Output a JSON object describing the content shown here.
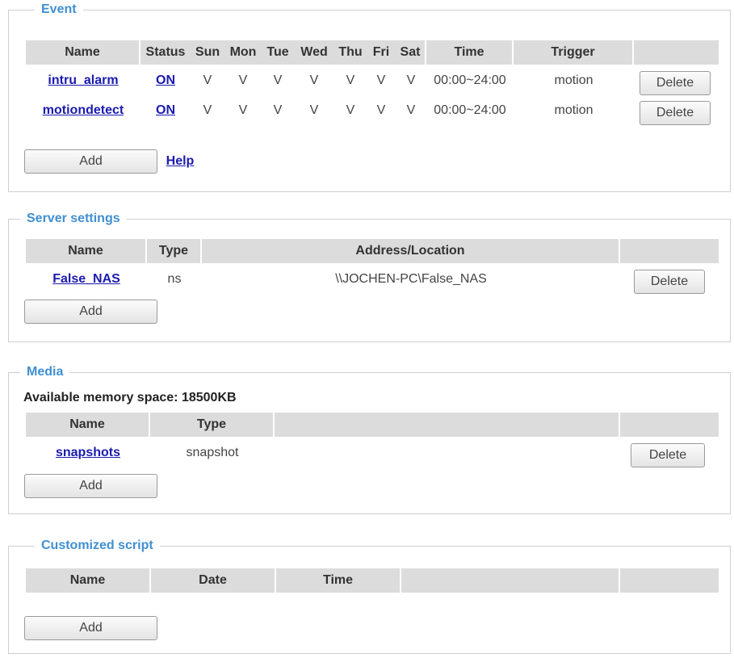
{
  "event": {
    "legend": "Event",
    "headers": [
      "Name",
      "Status",
      "Sun",
      "Mon",
      "Tue",
      "Wed",
      "Thu",
      "Fri",
      "Sat",
      "Time",
      "Trigger",
      ""
    ],
    "rows": [
      {
        "name": "intru_alarm",
        "status": "ON",
        "days": [
          "V",
          "V",
          "V",
          "V",
          "V",
          "V",
          "V"
        ],
        "time": "00:00~24:00",
        "trigger": "motion",
        "delete": "Delete"
      },
      {
        "name": "motiondetect",
        "status": "ON",
        "days": [
          "V",
          "V",
          "V",
          "V",
          "V",
          "V",
          "V"
        ],
        "time": "00:00~24:00",
        "trigger": "motion",
        "delete": "Delete"
      }
    ],
    "add_label": "Add",
    "help_label": "Help"
  },
  "server": {
    "legend": "Server settings",
    "headers": [
      "Name",
      "Type",
      "Address/Location",
      ""
    ],
    "rows": [
      {
        "name": "False_NAS",
        "type": "ns",
        "address": "\\\\JOCHEN-PC\\False_NAS",
        "delete": "Delete"
      }
    ],
    "add_label": "Add"
  },
  "media": {
    "legend": "Media",
    "memory_label": "Available memory space:",
    "memory_value": "18500KB",
    "headers": [
      "Name",
      "Type",
      "",
      ""
    ],
    "rows": [
      {
        "name": "snapshots",
        "type": "snapshot",
        "delete": "Delete"
      }
    ],
    "add_label": "Add"
  },
  "script": {
    "legend": "Customized script",
    "headers": [
      "Name",
      "Date",
      "Time",
      "",
      ""
    ],
    "add_label": "Add"
  }
}
